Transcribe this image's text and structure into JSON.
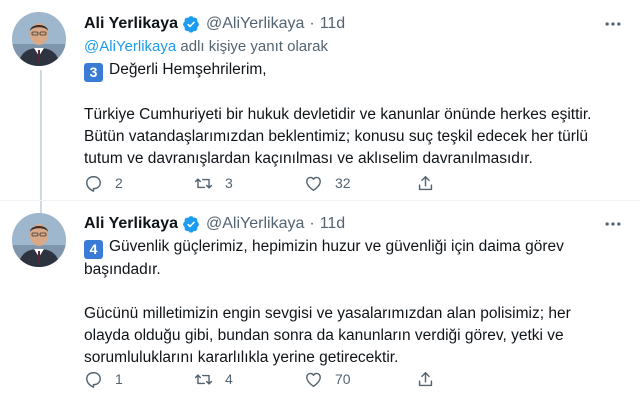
{
  "theme": {
    "text": "#0f1419",
    "muted": "#536471",
    "link": "#1d9bf0",
    "keycap": "#3a7bd5",
    "verified": "#1d9bf0"
  },
  "tweets": [
    {
      "author_name": "Ali Yerlikaya",
      "handle": "@AliYerlikaya",
      "separator": "·",
      "time": "11d",
      "reply_to_mention": "@AliYerlikaya",
      "reply_to_text": "adlı kişiye yanıt olarak",
      "number_badge": "3",
      "lines": [
        "Değerli Hemşehrilerim,",
        "",
        "Türkiye Cumhuriyeti bir hukuk devletidir ve kanunlar önünde herkes eşittir.",
        "Bütün vatandaşlarımızdan beklentimiz; konusu suç teşkil edecek her türlü",
        "tutum ve davranışlardan kaçınılması ve aklıselim davranılmasıdır."
      ],
      "replies": "2",
      "retweets": "3",
      "likes": "32",
      "icons": {
        "reply": "reply-icon",
        "retweet": "retweet-icon",
        "like": "heart-icon",
        "share": "share-icon",
        "more": "more-icon",
        "verified": "verified-badge-icon"
      }
    },
    {
      "author_name": "Ali Yerlikaya",
      "handle": "@AliYerlikaya",
      "separator": "·",
      "time": "11d",
      "number_badge": "4",
      "lines": [
        "Güvenlik güçlerimiz, hepimizin huzur ve güvenliği için daima görev",
        "başındadır.",
        "",
        "Gücünü milletimizin engin sevgisi ve yasalarımızdan alan polisimiz; her",
        "olayda olduğu gibi, bundan sonra da kanunların verdiği görev, yetki ve",
        "sorumluluklarını kararlılıkla yerine getirecektir."
      ],
      "replies": "1",
      "retweets": "4",
      "likes": "70",
      "icons": {
        "reply": "reply-icon",
        "retweet": "retweet-icon",
        "like": "heart-icon",
        "share": "share-icon",
        "more": "more-icon",
        "verified": "verified-badge-icon"
      }
    }
  ]
}
